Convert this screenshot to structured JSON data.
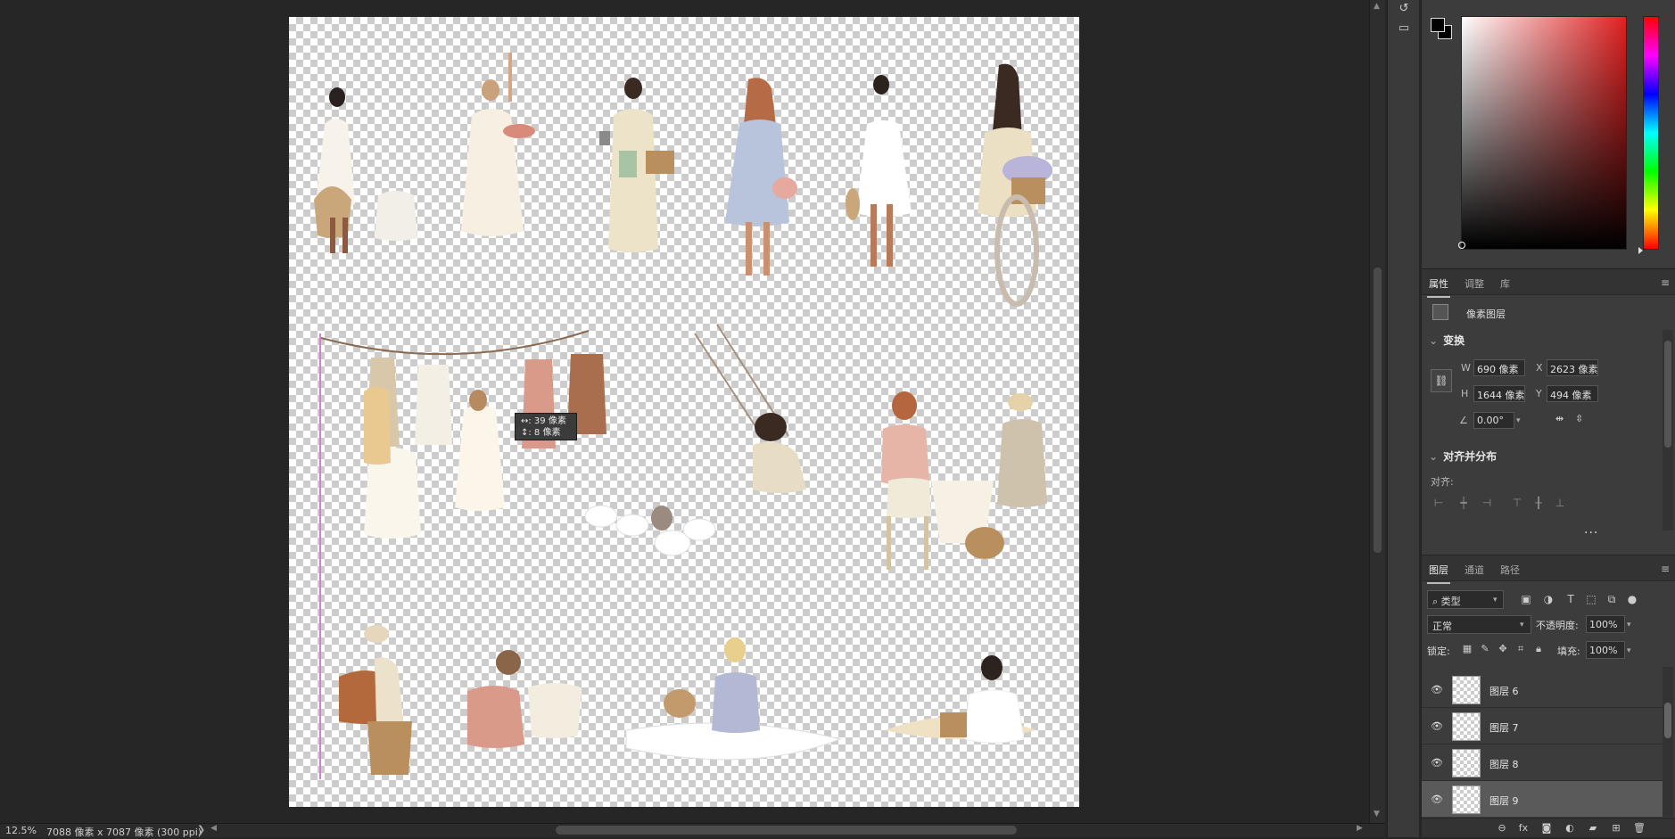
{
  "status_bar": {
    "zoom": "12.5%",
    "doc_info": "7088 像素 x 7087 像素 (300 ppi)",
    "chevron": "❯"
  },
  "canvas": {
    "tooltip_line1": "↔: 39 像素",
    "tooltip_line2": "↕:   8 像素",
    "colors": {
      "checker_light": "#ffffff",
      "checker_dark": "#cccccc",
      "guide": "#d67cd8"
    }
  },
  "icon_strip": {
    "icons": [
      "history-icon",
      "comment-icon"
    ]
  },
  "color_panel": {
    "foreground": "#000000",
    "background": "#000000",
    "hue_color": "#e02020"
  },
  "properties_panel": {
    "tabs": [
      {
        "label": "属性",
        "active": true
      },
      {
        "label": "调整",
        "active": false
      },
      {
        "label": "库",
        "active": false
      }
    ],
    "layer_type": "像素图层",
    "transform": {
      "title": "变换",
      "w_label": "W",
      "w_value": "690 像素",
      "h_label": "H",
      "h_value": "1644 像素",
      "x_label": "X",
      "x_value": "2623 像素",
      "y_label": "Y",
      "y_value": "494 像素",
      "angle_value": "0.00°"
    },
    "align": {
      "title": "对齐并分布",
      "label": "对齐:",
      "more": "..."
    }
  },
  "layers_panel": {
    "tabs": [
      {
        "label": "图层",
        "active": true
      },
      {
        "label": "通道",
        "active": false
      },
      {
        "label": "路径",
        "active": false
      }
    ],
    "filter_kind": "类型",
    "blend_mode": "正常",
    "opacity_label": "不透明度:",
    "opacity_value": "100%",
    "lock_label": "锁定:",
    "fill_label": "填充:",
    "fill_value": "100%",
    "layers": [
      {
        "name": "图层 6",
        "visible": true,
        "selected": false
      },
      {
        "name": "图层 7",
        "visible": true,
        "selected": false
      },
      {
        "name": "图层 8",
        "visible": true,
        "selected": false
      },
      {
        "name": "图层 9",
        "visible": true,
        "selected": true
      }
    ]
  }
}
